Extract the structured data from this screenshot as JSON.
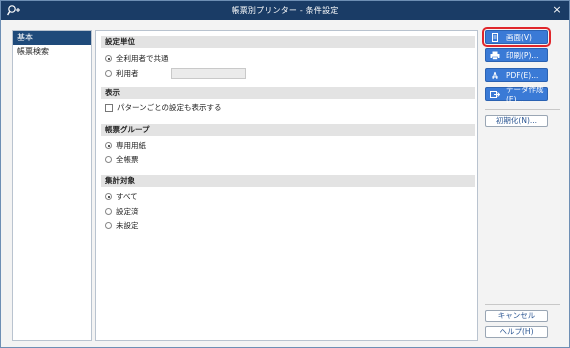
{
  "window": {
    "title": "帳票別プリンター - 条件設定",
    "close_glyph": "×"
  },
  "nav": {
    "items": [
      {
        "label": "基本"
      },
      {
        "label": "帳票検索"
      }
    ]
  },
  "sections": {
    "unit": {
      "title": "設定単位",
      "opt_shared": "全利用者で共通",
      "opt_user": "利用者"
    },
    "display": {
      "title": "表示",
      "opt_pattern": "パターンごとの設定も表示する"
    },
    "group": {
      "title": "帳票グループ",
      "opt_dedicated": "専用用紙",
      "opt_all": "全帳票"
    },
    "target": {
      "title": "集計対象",
      "opt_all": "すべて",
      "opt_set": "設定済",
      "opt_unset": "未設定"
    }
  },
  "buttons": {
    "screen": "画面(V)",
    "print": "印刷(P)...",
    "pdf": "PDF(E)...",
    "data": "データ作成(E)...",
    "init": "初期化(N)...",
    "cancel": "キャンセル",
    "help": "ヘルプ(H)"
  },
  "icons": {
    "app": "magnifier-plus-icon",
    "screen": "screen-doc-icon",
    "print": "printer-icon",
    "pdf": "pdf-icon",
    "data": "export-arrow-icon"
  },
  "colors": {
    "titlebar": "#1a3c66",
    "accent": "#3a7ad6",
    "highlight": "#e0262b",
    "nav_active": "#1f4a7a"
  }
}
